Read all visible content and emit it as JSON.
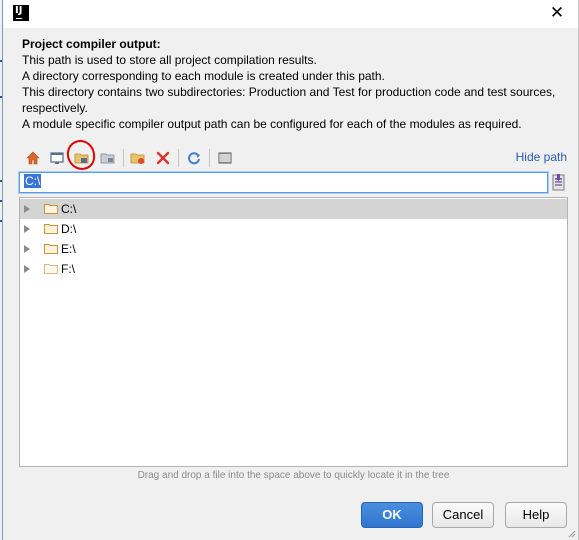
{
  "window": {
    "app_icon_text": "IJ",
    "close_glyph": "✕"
  },
  "description": {
    "title": "Project compiler output:",
    "lines": [
      "This path is used to store all project compilation results.",
      "A directory corresponding to each module is created under this path.",
      "This directory contains two subdirectories: Production and Test for production code and test sources, respectively.",
      "A module specific compiler output path can be configured for each of the modules as required."
    ]
  },
  "toolbar": {
    "icons": [
      "home-icon",
      "desktop-icon",
      "project-folder-icon",
      "module-folder-icon",
      "new-folder-icon",
      "delete-icon",
      "refresh-icon",
      "show-hidden-icon"
    ],
    "hide_path_label": "Hide path"
  },
  "path": {
    "value": "C:\\"
  },
  "tree": {
    "items": [
      {
        "label": "C:\\",
        "selected": true
      },
      {
        "label": "D:\\",
        "selected": false
      },
      {
        "label": "E:\\",
        "selected": false
      },
      {
        "label": "F:\\",
        "selected": false
      }
    ]
  },
  "hint": "Drag and drop a file into the space above to quickly locate it in the tree",
  "buttons": {
    "ok": "OK",
    "cancel": "Cancel",
    "help": "Help"
  },
  "colors": {
    "accent": "#3875d7",
    "link": "#2a5db0",
    "folder": "#c8933c",
    "annotation": "#e00000"
  }
}
